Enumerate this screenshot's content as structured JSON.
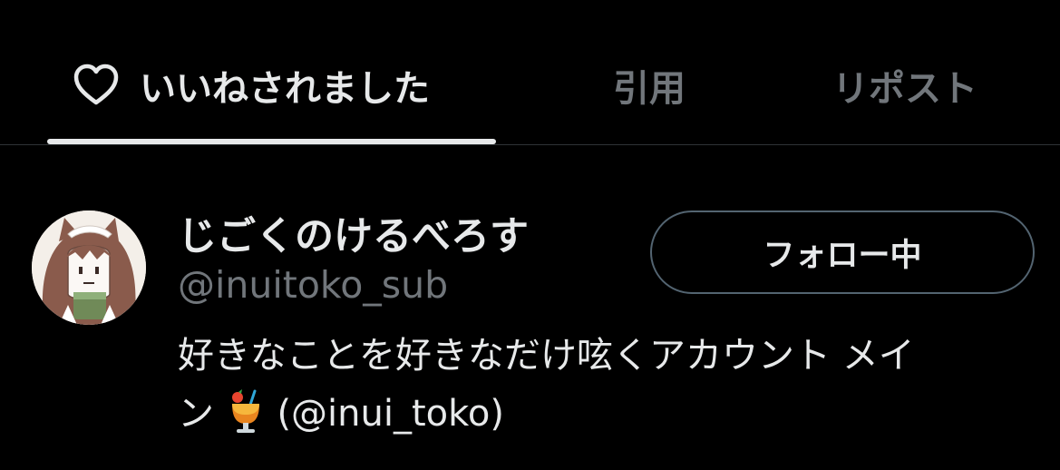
{
  "tabs": [
    {
      "label": "いいねされました",
      "icon": "heart-icon",
      "active": true
    },
    {
      "label": "引用",
      "active": false
    },
    {
      "label": "リポスト",
      "active": false
    }
  ],
  "user": {
    "display_name": "じごくのけるべろす",
    "handle": "@inuitoko_sub",
    "follow_button_label": "フォロー中",
    "bio_line1": "好きなことを好きなだけ呟くアカウント メイ",
    "bio_line2_prefix": "ン",
    "bio_emoji": "tropical-drink-icon",
    "bio_line2_suffix": "(@inui_toko)"
  },
  "colors": {
    "background": "#000000",
    "primary_text": "#e7e9ea",
    "secondary_text": "#71767b",
    "divider": "#2f3336",
    "button_border": "#536471"
  }
}
